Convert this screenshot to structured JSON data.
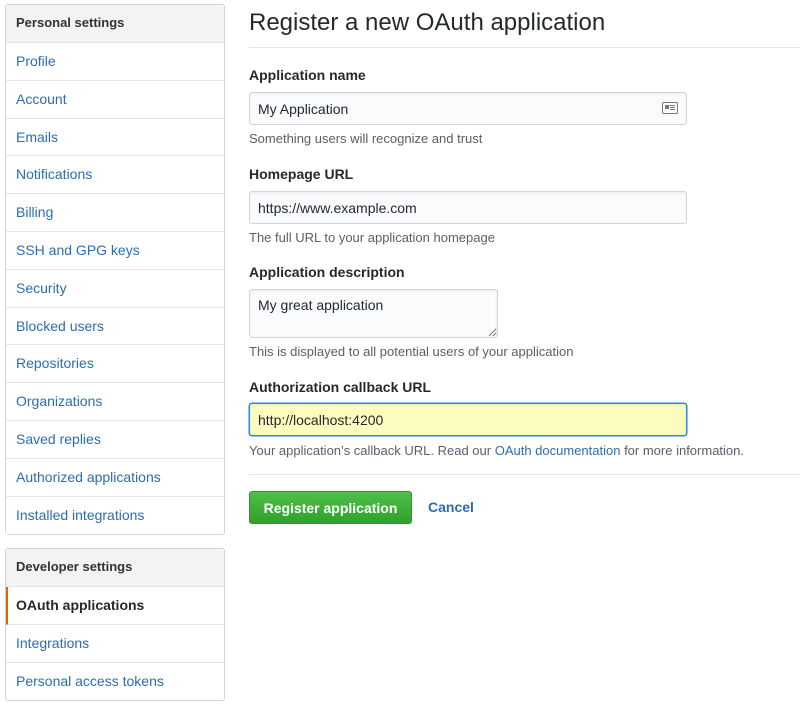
{
  "personal_menu": {
    "heading": "Personal settings",
    "items": [
      {
        "label": "Profile"
      },
      {
        "label": "Account"
      },
      {
        "label": "Emails"
      },
      {
        "label": "Notifications"
      },
      {
        "label": "Billing"
      },
      {
        "label": "SSH and GPG keys"
      },
      {
        "label": "Security"
      },
      {
        "label": "Blocked users"
      },
      {
        "label": "Repositories"
      },
      {
        "label": "Organizations"
      },
      {
        "label": "Saved replies"
      },
      {
        "label": "Authorized applications"
      },
      {
        "label": "Installed integrations"
      }
    ]
  },
  "developer_menu": {
    "heading": "Developer settings",
    "items": [
      {
        "label": "OAuth applications",
        "selected": true
      },
      {
        "label": "Integrations"
      },
      {
        "label": "Personal access tokens"
      }
    ]
  },
  "form": {
    "title": "Register a new OAuth application",
    "app_name": {
      "label": "Application name",
      "value": "My Application",
      "note": "Something users will recognize and trust"
    },
    "homepage": {
      "label": "Homepage URL",
      "value": "https://www.example.com",
      "note": "The full URL to your application homepage"
    },
    "description": {
      "label": "Application description",
      "value": "My great application",
      "note": "This is displayed to all potential users of your application"
    },
    "callback": {
      "label": "Authorization callback URL",
      "value": "http://localhost:4200",
      "note_before": "Your application’s callback URL. Read our ",
      "note_link": "OAuth documentation",
      "note_after": " for more information."
    },
    "submit_label": "Register application",
    "cancel_label": "Cancel"
  },
  "colors": {
    "accent_link": "#2c6db2",
    "primary_button": "#3aae33",
    "selected_marker": "#e36209",
    "highlight_field": "#fcfcbf"
  },
  "icons": {
    "app_name_field": "address-card-icon"
  }
}
